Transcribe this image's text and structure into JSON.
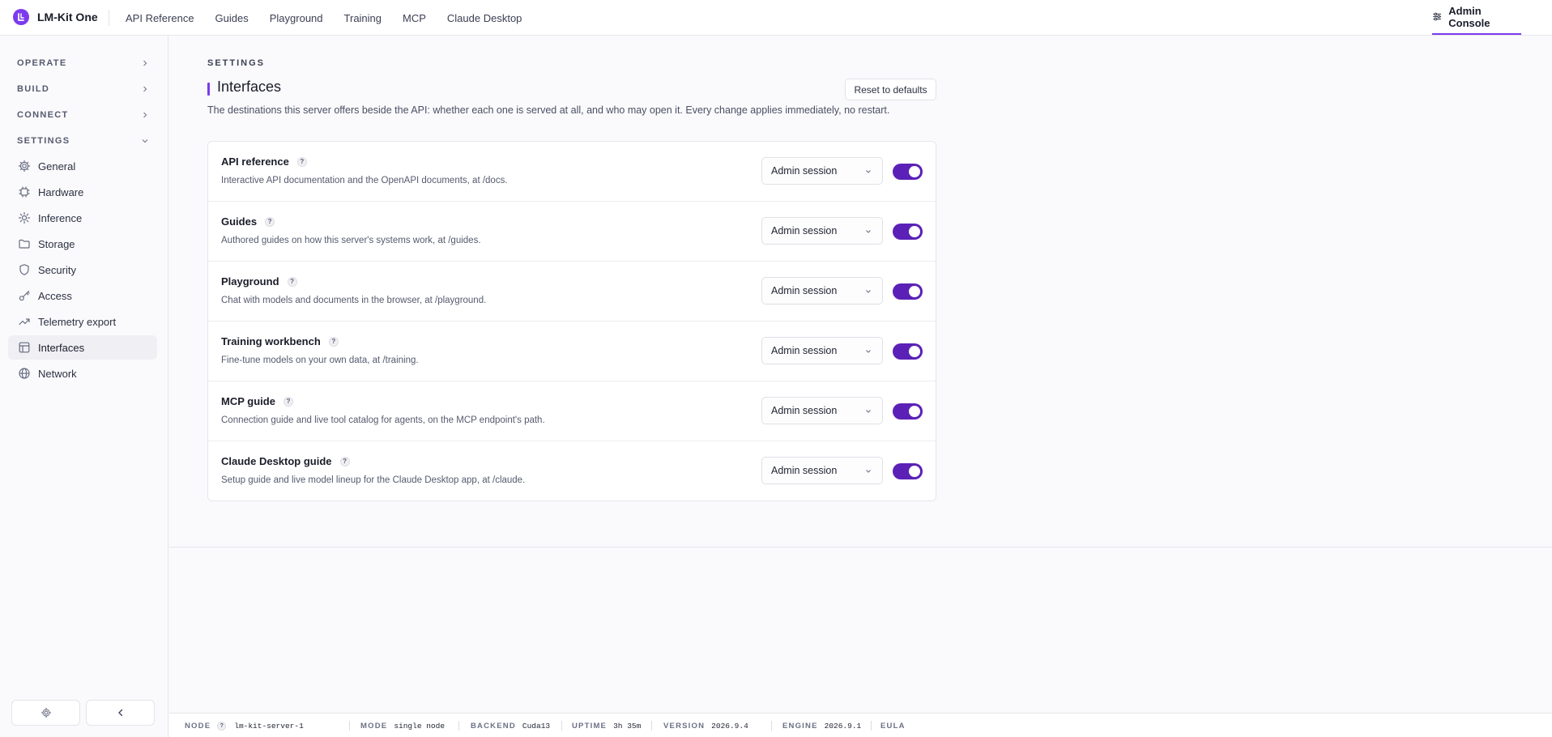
{
  "app": {
    "name": "LM-Kit One"
  },
  "topnav": [
    {
      "label": "API Reference"
    },
    {
      "label": "Guides"
    },
    {
      "label": "Playground"
    },
    {
      "label": "Training"
    },
    {
      "label": "MCP"
    },
    {
      "label": "Claude Desktop"
    }
  ],
  "admin": {
    "label": "Admin Console",
    "icon": "sliders-icon"
  },
  "sidebar": {
    "sections": [
      {
        "label": "OPERATE",
        "state": "collapsed"
      },
      {
        "label": "BUILD",
        "state": "collapsed"
      },
      {
        "label": "CONNECT",
        "state": "collapsed"
      },
      {
        "label": "SETTINGS",
        "state": "expanded"
      }
    ],
    "items": [
      {
        "label": "General",
        "icon": "gear-icon"
      },
      {
        "label": "Hardware",
        "icon": "chip-icon"
      },
      {
        "label": "Inference",
        "icon": "sun-icon"
      },
      {
        "label": "Storage",
        "icon": "folder-icon"
      },
      {
        "label": "Security",
        "icon": "shield-icon"
      },
      {
        "label": "Access",
        "icon": "key-icon"
      },
      {
        "label": "Telemetry export",
        "icon": "trend-icon"
      },
      {
        "label": "Interfaces",
        "icon": "layout-icon",
        "active": true
      },
      {
        "label": "Network",
        "icon": "globe-icon"
      }
    ]
  },
  "page": {
    "breadcrumb": "SETTINGS",
    "title": "Interfaces",
    "reset_label": "Reset to defaults",
    "description": "The destinations this server offers beside the API: whether each one is served at all, and who may open it. Every change applies immediately, no restart."
  },
  "help_glyph": "?",
  "interfaces": [
    {
      "name": "API reference",
      "description": "Interactive API documentation and the OpenAPI documents, at /docs.",
      "access": "Admin session",
      "enabled": true
    },
    {
      "name": "Guides",
      "description": "Authored guides on how this server's systems work, at /guides.",
      "access": "Admin session",
      "enabled": true
    },
    {
      "name": "Playground",
      "description": "Chat with models and documents in the browser, at /playground.",
      "access": "Admin session",
      "enabled": true
    },
    {
      "name": "Training workbench",
      "description": "Fine-tune models on your own data, at /training.",
      "access": "Admin session",
      "enabled": true
    },
    {
      "name": "MCP guide",
      "description": "Connection guide and live tool catalog for agents, on the MCP endpoint's path.",
      "access": "Admin session",
      "enabled": true
    },
    {
      "name": "Claude Desktop guide",
      "description": "Setup guide and live model lineup for the Claude Desktop app, at /claude.",
      "access": "Admin session",
      "enabled": true
    }
  ],
  "footer": {
    "node_key": "NODE",
    "node": "lm-kit-server-1",
    "mode_key": "MODE",
    "mode": "single node",
    "backend_key": "BACKEND",
    "backend": "Cuda13",
    "uptime_key": "UPTIME",
    "uptime": "3h 35m",
    "version_key": "VERSION",
    "version": "2026.9.4",
    "engine_key": "ENGINE",
    "engine": "2026.9.1",
    "eula": "EULA"
  },
  "colors": {
    "accent": "#7c3aed",
    "toggle_on": "#5b21b6",
    "border": "#e6e6ec"
  }
}
